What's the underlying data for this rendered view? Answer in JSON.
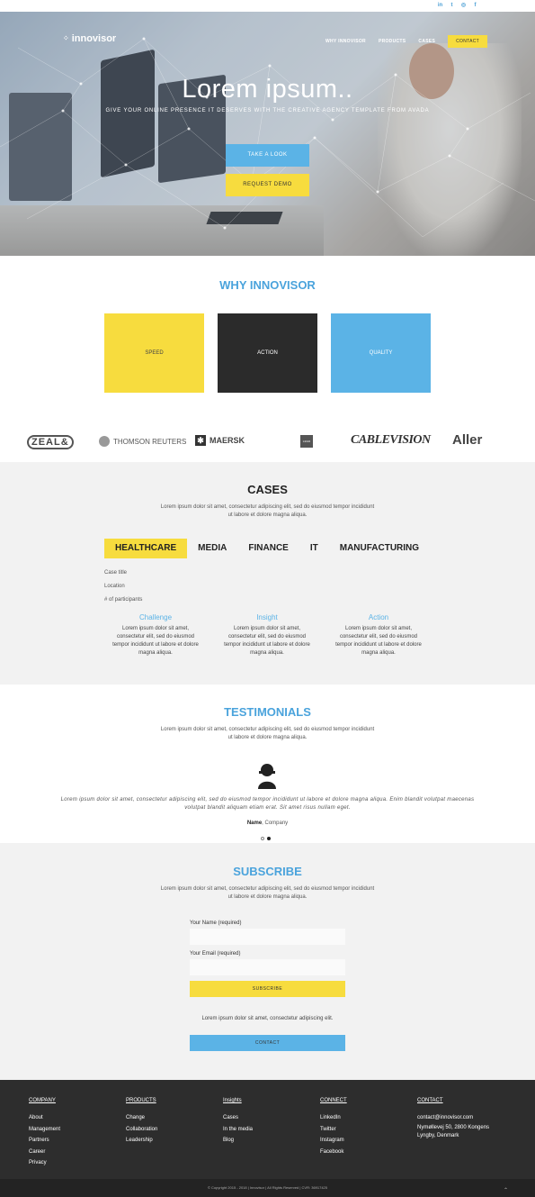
{
  "social": {
    "linkedin": "in",
    "twitter": "t",
    "instagram": "◎",
    "facebook": "f"
  },
  "brand": {
    "logo": "innovisor"
  },
  "nav": {
    "items": [
      "WHY INNOVISOR",
      "PRODUCTS",
      "CASES"
    ],
    "contact": "CONTACT"
  },
  "hero": {
    "title": "Lorem ipsum..",
    "subtitle": "GIVE YOUR ONLINE PRESENCE IT DESERVES WITH THE CREATIVE AGENCY TEMPLATE FROM AVADA",
    "cta_look": "TAKE A LOOK",
    "cta_demo": "REQUEST DEMO"
  },
  "why": {
    "title": "WHY INNOVISOR",
    "boxes": [
      "SPEED",
      "ACTION",
      "QUALITY"
    ]
  },
  "clients": [
    "ZEAL&",
    "THOMSON REUTERS",
    "MAERSK",
    "LEGO",
    "CABLEVISION",
    "Aller"
  ],
  "cases": {
    "title": "CASES",
    "lead1": "Lorem ipsum dolor sit amet, consectetur adipiscing elit, sed do eiusmod tempor incididunt",
    "lead2": "ut labore et dolore magna aliqua.",
    "tabs": [
      "HEALTHCARE",
      "MEDIA",
      "FINANCE",
      "IT",
      "MANUFACTURING"
    ],
    "meta": [
      "Case title",
      "Location",
      "# of participants"
    ],
    "columns": [
      {
        "title": "Challenge",
        "l1": "Lorem ipsum dolor sit amet,",
        "l2": "consectetur elit, sed do eiusmod",
        "l3": "tempor incididunt ut labore et dolore",
        "l4": "magna aliqua."
      },
      {
        "title": "Insight",
        "l1": "Lorem ipsum dolor sit amet,",
        "l2": "consectetur elit, sed do eiusmod",
        "l3": "tempor incididunt ut labore et dolore",
        "l4": "magna aliqua."
      },
      {
        "title": "Action",
        "l1": "Lorem ipsum dolor sit amet,",
        "l2": "consectetur elit, sed do eiusmod",
        "l3": "tempor incididunt ut labore et dolore",
        "l4": "magna aliqua."
      }
    ]
  },
  "testimonials": {
    "title": "TESTIMONIALS",
    "lead1": "Lorem ipsum dolor sit amet, consectetur adipiscing elit, sed do eiusmod tempor incididunt",
    "lead2": "ut labore et dolore magna aliqua.",
    "quote1": "Lorem ipsum dolor sit amet, consectetur adipiscing elit, sed do eiusmod tempor incididunt ut labore et dolore magna aliqua. Enim blandit volutpat maecenas",
    "quote2": "volutpat blandit aliquam etiam erat. Sit amet risus nullam eget.",
    "name": "Name",
    "company": ", Company"
  },
  "subscribe": {
    "title": "SUBSCRIBE",
    "lead1": "Lorem ipsum dolor sit amet, consectetur adipiscing elit, sed do eiusmod tempor incididunt",
    "lead2": "ut labore et dolore magna aliqua.",
    "name_label": "Your Name (required)",
    "email_label": "Your Email (required)",
    "subscribe_btn": "SUBSCRIBE",
    "note": "Lorem ipsum dolor sit amet, consectetur adipiscing elit.",
    "contact_btn": "CONTACT"
  },
  "footer": {
    "company": {
      "title": "COMPANY",
      "items": [
        "About",
        "Management",
        "Partners",
        "Career",
        "Privacy"
      ]
    },
    "products": {
      "title": "PRODUCTS",
      "items": [
        "Change",
        "Collaboration",
        "Leadership"
      ]
    },
    "insights": {
      "title": "Insights",
      "items": [
        "Cases",
        "In the media",
        "Blog"
      ]
    },
    "connect": {
      "title": "CONNECT",
      "items": [
        "LinkedIn",
        "Twitter",
        "Instagram",
        "Facebook"
      ]
    },
    "contact": {
      "title": "CONTACT",
      "email": "contact@innovisor.com",
      "addr1": "Nymøllevej 50, 2800 Kongens",
      "addr2": "Lyngby, Denmark"
    },
    "copyright": "© Copyright 2015 - 2018 | Innovisor | All Rights Reserved | CVR: 36917425",
    "up": "⌃"
  }
}
